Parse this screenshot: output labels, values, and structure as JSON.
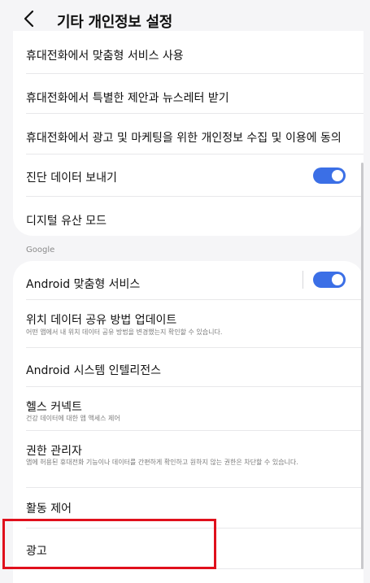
{
  "header": {
    "title": "기타 개인정보 설정"
  },
  "group1": {
    "items": [
      {
        "label": "휴대전화에서 맞춤형 서비스 사용"
      },
      {
        "label": "휴대전화에서 특별한 제안과 뉴스레터 받기"
      },
      {
        "label": "휴대전화에서 광고 및 마케팅을 위한 개인정보 수집 및 이용에 동의"
      },
      {
        "label": "진단 데이터 보내기",
        "toggle_on": true
      },
      {
        "label": "디지털 유산 모드"
      }
    ]
  },
  "section_google": {
    "label": "Google"
  },
  "group2": {
    "items": [
      {
        "label": "Android 맞춤형 서비스",
        "toggle_on": true
      },
      {
        "label": "위치 데이터 공유 방법 업데이트",
        "sub": "어떤 앱에서 내 위치 데이터 공유 방법을 변경했는지 확인할 수 있습니다."
      },
      {
        "label": "Android 시스템 인텔리전스"
      },
      {
        "label": "헬스 커넥트",
        "sub": "건강 데이터에 대한 앱 액세스 제어"
      },
      {
        "label": "권한 관리자",
        "sub": "앱에 허용된 휴대전화 기능이나 데이터를 간편하게 확인하고 원하지 않는 권한은 차단할 수 있습니다."
      },
      {
        "label": "활동 제어"
      },
      {
        "label": "광고"
      }
    ]
  },
  "colors": {
    "accent": "#3b6fe6",
    "highlight": "#e0101c",
    "background": "#f5f5f7"
  }
}
